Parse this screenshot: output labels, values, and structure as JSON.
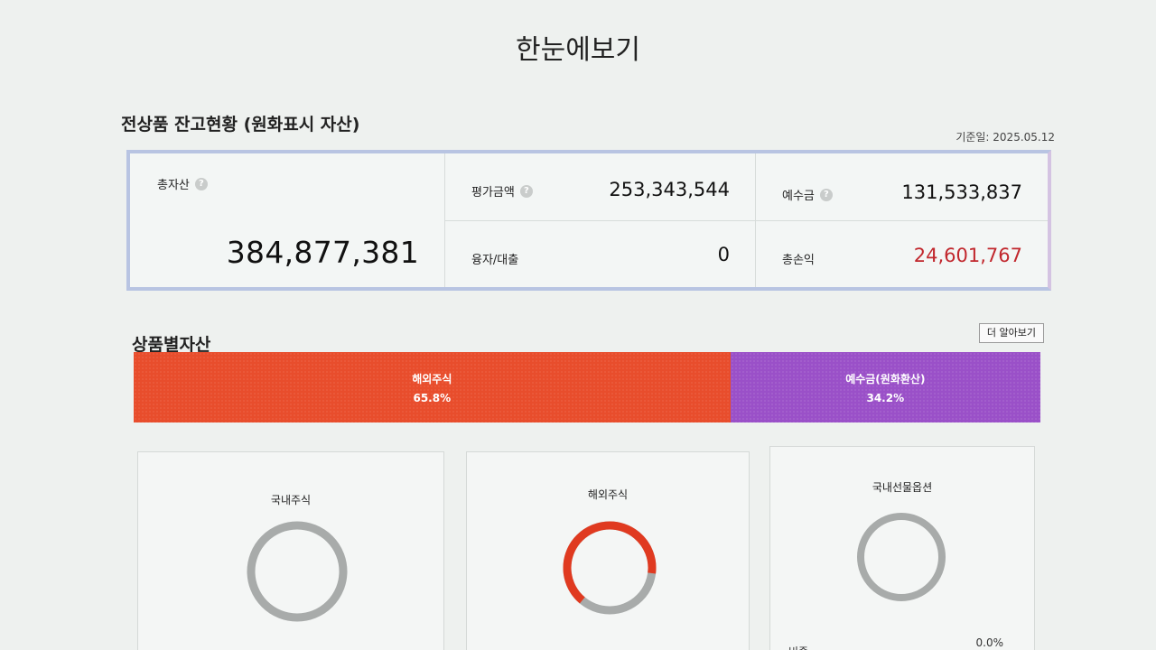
{
  "page": {
    "title": "한눈에보기"
  },
  "balance": {
    "section_title": "전상품 잔고현황 (원화표시 자산)",
    "base_date": "기준일: 2025.05.12",
    "total_assets": {
      "label": "총자산",
      "value": "384,877,381"
    },
    "eval_amount": {
      "label": "평가금액",
      "value": "253,343,544"
    },
    "deposit": {
      "label": "예수금",
      "value": "131,533,837"
    },
    "loan": {
      "label": "융자/대출",
      "value": "0"
    },
    "total_pnl": {
      "label": "총손익",
      "value": "24,601,767"
    },
    "help_icon": "?"
  },
  "by_product": {
    "section_title": "상품별자산",
    "more_label": "더 알아보기",
    "segments": [
      {
        "label": "해외주식",
        "percent_text": "65.8%",
        "share": 0.658,
        "color": "#e84d2c"
      },
      {
        "label": "예수금(원화환산)",
        "percent_text": "34.2%",
        "share": 0.342,
        "color": "#9a50c8"
      }
    ]
  },
  "cards": [
    {
      "title": "국내주식",
      "ratio": 0,
      "ring_color": "#a8abaa",
      "fill_color": "#e03a20"
    },
    {
      "title": "해외주식",
      "ratio": 0.658,
      "ring_color": "#a8abaa",
      "fill_color": "#e03a20"
    },
    {
      "title": "국내선물옵션",
      "ratio": 0,
      "ring_color": "#a8abaa",
      "fill_color": "#e03a20",
      "foot_label": "비중",
      "foot_value": "0.0%"
    }
  ],
  "colors": {
    "pnl_positive": "#c1272d"
  }
}
